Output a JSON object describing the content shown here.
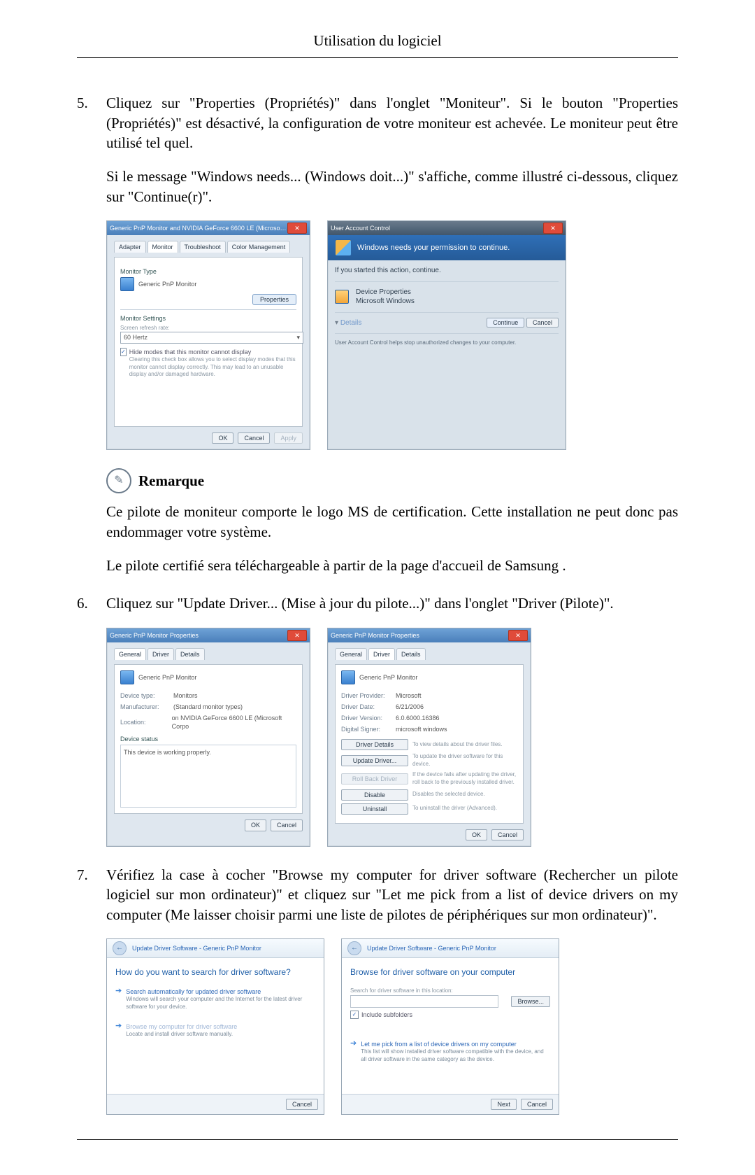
{
  "header": {
    "title": "Utilisation du logiciel"
  },
  "common": {
    "ok": "OK",
    "cancel": "Cancel",
    "apply": "Apply",
    "next": "Next"
  },
  "steps": [
    {
      "num": "5.",
      "p1": "Cliquez sur \"Properties (Propriétés)\" dans l'onglet \"Moniteur\". Si le bouton \"Properties (Propriétés)\" est désactivé, la configuration de votre moniteur est achevée. Le moniteur peut être utilisé tel quel.",
      "p2": "Si le message \"Windows needs... (Windows doit...)\" s'affiche, comme illustré ci-dessous, cliquez sur \"Continue(r)\"."
    },
    {
      "num": "6.",
      "p1": "Cliquez sur \"Update Driver... (Mise à jour du pilote...)\" dans l'onglet \"Driver (Pilote)\"."
    },
    {
      "num": "7.",
      "p1": "Vérifiez la case à cocher \"Browse my computer for driver software (Rechercher un pilote logiciel sur mon ordinateur)\" et cliquez sur \"Let me pick from a list of device drivers on my computer (Me laisser choisir parmi une liste de pilotes de périphériques sur mon ordinateur)\"."
    }
  ],
  "note": {
    "title": "Remarque",
    "p1": "Ce pilote de moniteur comporte le logo MS de certification. Cette installation ne peut donc pas endommager votre système.",
    "p2": "Le pilote certifié sera téléchargeable à partir de la page d'accueil de Samsung ."
  },
  "shot1": {
    "win1": {
      "title": "Generic PnP Monitor and NVIDIA GeForce 6600 LE (Microsoft Co...",
      "tabs": [
        "Adapter",
        "Monitor",
        "Troubleshoot",
        "Color Management"
      ],
      "sec1": "Monitor Type",
      "monitor_type": "Generic PnP Monitor",
      "props_btn": "Properties",
      "sec2": "Monitor Settings",
      "refresh_label": "Screen refresh rate:",
      "refresh_value": "60 Hertz",
      "hide_label": "Hide modes that this monitor cannot display",
      "hide_desc": "Clearing this check box allows you to select display modes that this monitor cannot display correctly. This may lead to an unusable display and/or damaged hardware."
    },
    "uac": {
      "title": "User Account Control",
      "headline": "Windows needs your permission to continue.",
      "intro": "If you started this action, continue.",
      "program": "Device Properties",
      "publisher": "Microsoft Windows",
      "details": "Details",
      "continue": "Continue",
      "footnote": "User Account Control helps stop unauthorized changes to your computer."
    }
  },
  "shot2": {
    "title": "Generic PnP Monitor Properties",
    "name": "Generic PnP Monitor",
    "tabs": [
      "General",
      "Driver",
      "Details"
    ],
    "general": {
      "k0": "Device type:",
      "v0": "Monitors",
      "k1": "Manufacturer:",
      "v1": "(Standard monitor types)",
      "k2": "Location:",
      "v2": "on NVIDIA GeForce 6600 LE (Microsoft Corpo",
      "status_label": "Device status",
      "status": "This device is working properly."
    },
    "driver": {
      "k0": "Driver Provider:",
      "v0": "Microsoft",
      "k1": "Driver Date:",
      "v1": "6/21/2006",
      "k2": "Driver Version:",
      "v2": "6.0.6000.16386",
      "k3": "Digital Signer:",
      "v3": "microsoft windows",
      "btns": [
        {
          "l": "Driver Details",
          "d": "To view details about the driver files."
        },
        {
          "l": "Update Driver...",
          "d": "To update the driver software for this device."
        },
        {
          "l": "Roll Back Driver",
          "d": "If the device fails after updating the driver, roll back to the previously installed driver."
        },
        {
          "l": "Disable",
          "d": "Disables the selected device."
        },
        {
          "l": "Uninstall",
          "d": "To uninstall the driver (Advanced)."
        }
      ]
    }
  },
  "shot3": {
    "crumb": "Update Driver Software - Generic PnP Monitor",
    "left": {
      "head": "How do you want to search for driver software?",
      "opt1": {
        "t": "Search automatically for updated driver software",
        "d": "Windows will search your computer and the Internet for the latest driver software for your device."
      },
      "opt2": {
        "t": "Browse my computer for driver software",
        "d": "Locate and install driver software manually."
      }
    },
    "right": {
      "head": "Browse for driver software on your computer",
      "loc_label": "Search for driver software in this location:",
      "browse": "Browse...",
      "include": "Include subfolders",
      "opt": {
        "t": "Let me pick from a list of device drivers on my computer",
        "d": "This list will show installed driver software compatible with the device, and all driver software in the same category as the device."
      }
    }
  }
}
